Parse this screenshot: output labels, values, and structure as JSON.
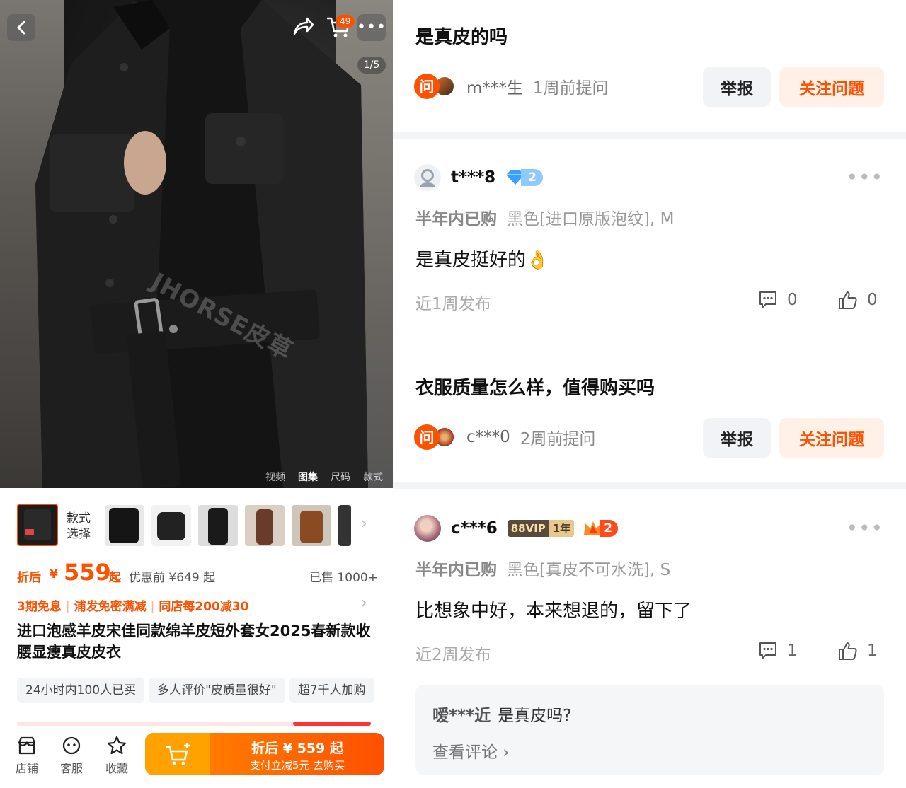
{
  "product": {
    "cart_badge": "49",
    "page_indicator": "1/5",
    "watermark": "JHORSE皮草",
    "media_tabs": [
      "视频",
      "图集",
      "尺码",
      "款式"
    ],
    "media_tab_active": "图集",
    "style_label_line1": "款式",
    "style_label_line2": "选择",
    "price_prefix": "折后",
    "price_currency": "¥",
    "price_value": "559",
    "price_suffix": "起",
    "price_before": "优惠前 ¥649 起",
    "sold": "已售 1000+",
    "promos": [
      "3期免息",
      "浦发免密满减",
      "同店每200减30"
    ],
    "title": "进口泡感羊皮宋佳同款绵羊皮短外套女2025春新款收腰显瘦真皮皮衣",
    "tags": [
      "24小时内100人已买",
      "多人评价\"皮质量很好\"",
      "超7千人加购"
    ],
    "bottom": {
      "shop": "店铺",
      "service": "客服",
      "favorite": "收藏",
      "buy_main": "折后 ¥ 559 起",
      "buy_sub": "支付立减5元 去购买"
    }
  },
  "qa": [
    {
      "question": "是真皮的吗",
      "asker": "m***生",
      "time": "1周前提问",
      "report": "举报",
      "follow": "关注问题",
      "badge": "问"
    },
    {
      "question": "衣服质量怎么样，值得购买吗",
      "asker": "c***0",
      "time": "2周前提问",
      "report": "举报",
      "follow": "关注问题",
      "badge": "问"
    }
  ],
  "answers": [
    {
      "user": "t***8",
      "level": "2",
      "purchase_label": "半年内已购",
      "sku": "黑色[进口原版泡纹], M",
      "text": "是真皮挺好的👌",
      "when": "近1周发布",
      "comments": "0",
      "likes": "0"
    },
    {
      "user": "c***6",
      "vip_a": "88VIP",
      "vip_b": "1年",
      "level": "2",
      "purchase_label": "半年内已购",
      "sku": "黑色[真皮不可水洗], S",
      "text": "比想象中好，本来想退的，留下了",
      "when": "近2周发布",
      "comments": "1",
      "likes": "1",
      "sub_comment_user": "嗳***近",
      "sub_comment_text": "是真皮吗?",
      "view_comments": "查看评论 ›"
    }
  ],
  "colors": {
    "accent": "#ff5000",
    "follow_bg": "#fff0e8",
    "report_bg": "#f1f3f6"
  }
}
